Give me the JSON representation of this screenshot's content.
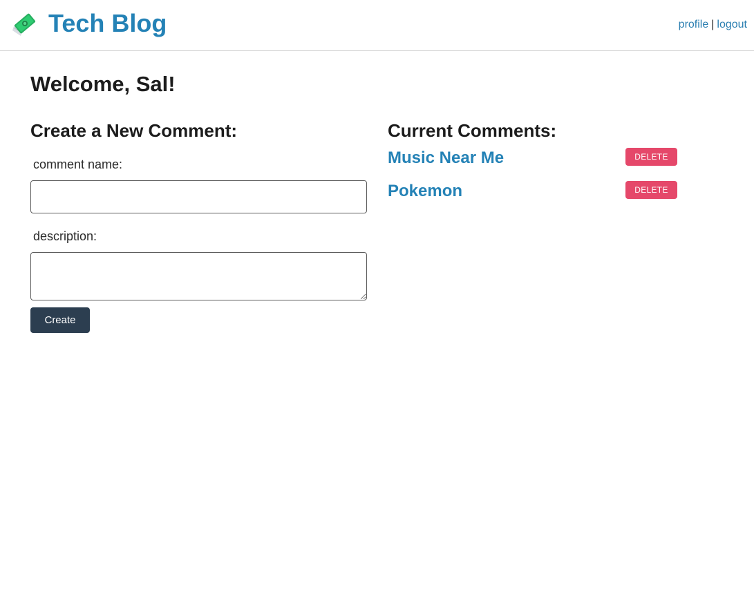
{
  "header": {
    "logo_icon": "money-with-wings-icon",
    "site_title": "Tech Blog",
    "nav": {
      "profile": "profile",
      "separator": "|",
      "logout": "logout"
    }
  },
  "welcome": "Welcome, Sal!",
  "create_form": {
    "title": "Create a New Comment:",
    "name_label": "comment name:",
    "name_value": "",
    "description_label": "description:",
    "description_value": "",
    "submit_label": "Create"
  },
  "current_comments": {
    "title": "Current Comments:",
    "items": [
      {
        "name": "Music Near Me",
        "delete_label": "DELETE"
      },
      {
        "name": "Pokemon",
        "delete_label": "DELETE"
      }
    ]
  },
  "colors": {
    "link_blue": "#2482b6",
    "create_button": "#2c3e50",
    "delete_button": "#e5486a",
    "logo_green": "#2ecc71"
  }
}
